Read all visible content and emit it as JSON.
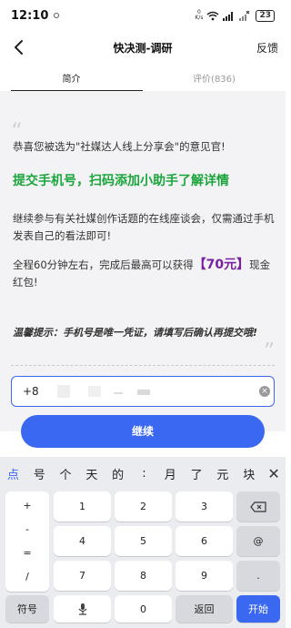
{
  "status_bar": {
    "time": "12:10",
    "net_speed_top": "0",
    "net_speed_bottom": "K/s",
    "battery": "23"
  },
  "header": {
    "title": "快决测-调研",
    "feedback": "反馈"
  },
  "tabs": [
    {
      "label": "简介"
    },
    {
      "label": "评价(836)"
    }
  ],
  "content": {
    "quote_open": "“",
    "quote_close": "”",
    "p1": "恭喜您被选为\"社媒达人线上分享会\"的意见官!",
    "p2": "提交手机号，扫码添加小助手了解详情",
    "p3": "继续参与有关社媒创作话题的在线座谈会，仅需通过手机发表自己的看法即可!",
    "p4_before": "全程60分钟左右，完成后最高可以获得",
    "p4_price": "【70元】",
    "p4_after": "现金红包!",
    "p5": "温馨提示：手机号是唯一凭证，请填写后确认再提交哦!"
  },
  "phone_input": {
    "value": "+8"
  },
  "submit": {
    "label": "继续"
  },
  "keyboard": {
    "candidates": [
      "点",
      "号",
      "个",
      "天",
      "的",
      ":",
      "月",
      "了",
      "元",
      "块"
    ],
    "side_keys": [
      "+",
      "-",
      "=",
      "/"
    ],
    "num_rows": [
      [
        "1",
        "2",
        "3"
      ],
      [
        "4",
        "5",
        "6"
      ],
      [
        "7",
        "8",
        "9"
      ]
    ],
    "at": "@",
    "dot": ".",
    "symbol": "符号",
    "zero": "0",
    "back": "返回",
    "enter": "开始"
  },
  "colors": {
    "accent": "#3a68f0",
    "highlight_green": "#1aa53c",
    "price_purple": "#7b1fa2"
  }
}
